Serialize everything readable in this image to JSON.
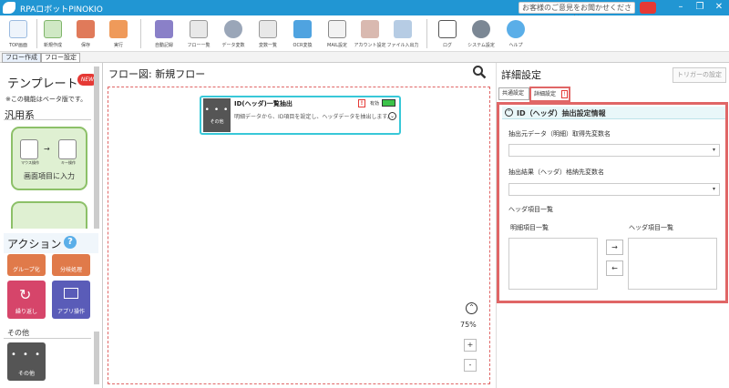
{
  "window": {
    "title": "RPAロボットPINOKIO",
    "feedback": "お客様のご意見をお聞かせください",
    "controls": [
      "–",
      "❐",
      "✕"
    ]
  },
  "ribbon": {
    "items": [
      {
        "label": "TOP画面",
        "icon": "home-icon"
      },
      {
        "label": "新規作成",
        "icon": "new-icon"
      },
      {
        "label": "保存",
        "icon": "save-icon"
      },
      {
        "label": "実行",
        "icon": "run-icon"
      },
      {
        "label": "自動記録",
        "icon": "record-icon"
      },
      {
        "label": "フロー一覧",
        "icon": "flow-list-icon"
      },
      {
        "label": "データ変数",
        "icon": "data-variable-icon"
      },
      {
        "label": "変数一覧",
        "icon": "variable-list-icon"
      },
      {
        "label": "OCR変換",
        "icon": "ocr-icon"
      },
      {
        "label": "MAIL設定",
        "icon": "mail-icon"
      },
      {
        "label": "アカウント設定",
        "icon": "account-icon"
      },
      {
        "label": "ファイル入出力",
        "icon": "file-io-icon"
      },
      {
        "label": "ログ",
        "icon": "log-icon"
      },
      {
        "label": "システム設定",
        "icon": "system-settings-icon"
      },
      {
        "label": "ヘルプ",
        "icon": "help-icon"
      }
    ]
  },
  "tabs": [
    "フロー作成",
    "フロー設定"
  ],
  "left_panel": {
    "template_title": "テンプレート",
    "new_badge": "NEW",
    "beta_note": "※この機能はベータ版です。",
    "category": "汎用系",
    "template_card": {
      "caption": "画面項目に入力",
      "mouse_label": "マウス操作",
      "key_label": "キー操作"
    },
    "action_title": "アクション",
    "help_mark": "?",
    "actions": [
      "グループ化",
      "分岐処理",
      "繰り返し",
      "アプリ操作"
    ],
    "other_label": "その他",
    "other_item": "その他"
  },
  "flow": {
    "title": "フロー図: 新規フロー",
    "node": {
      "title": "ID(ヘッダ)一覧抽出",
      "category": "その他",
      "enabled_label": "有効",
      "warning": "!",
      "description": "明細データから、ID項目を設定し、ヘッダデータを抽出します。"
    },
    "zoom": "75%",
    "zoom_in": "+",
    "zoom_out": "-"
  },
  "details": {
    "title": "詳細設定",
    "trigger_button": "トリガーの設定",
    "tab_common": "共通設定",
    "tab_detail": "詳細設定",
    "section_title": "ID（ヘッダ）抽出設定情報",
    "source_label": "抽出元データ（明細）取得先変数名",
    "result_label": "抽出結果（ヘッダ）格納先変数名",
    "header_items_label": "ヘッダ項目一覧",
    "detail_list_label": "明細項目一覧",
    "header_list_label": "ヘッダ項目一覧",
    "move_right": "→",
    "move_left": "←"
  },
  "colors": {
    "titlebar": "#2196d3",
    "accent_red": "#e06666",
    "node_border": "#38c8d8",
    "template_green": "#dff0d2"
  }
}
